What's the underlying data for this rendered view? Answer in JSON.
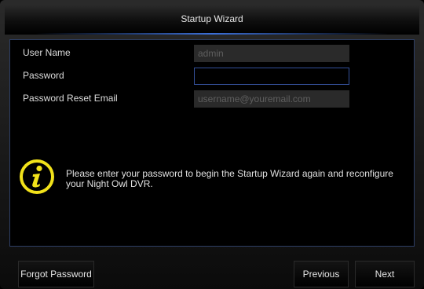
{
  "window": {
    "title": "Startup Wizard"
  },
  "form": {
    "user_name": {
      "label": "User Name",
      "value": "admin"
    },
    "password": {
      "label": "Password",
      "value": ""
    },
    "reset_email": {
      "label": "Password Reset Email",
      "placeholder": "username@youremail.com"
    }
  },
  "info": {
    "icon": "info-icon",
    "message": "Please enter your password to begin the Startup Wizard again and reconfigure your Night Owl DVR."
  },
  "buttons": {
    "forgot_password": "Forgot Password",
    "previous": "Previous",
    "next": "Next"
  },
  "colors": {
    "accent_blue": "#3b6fd8",
    "info_yellow": "#f2e21a"
  }
}
